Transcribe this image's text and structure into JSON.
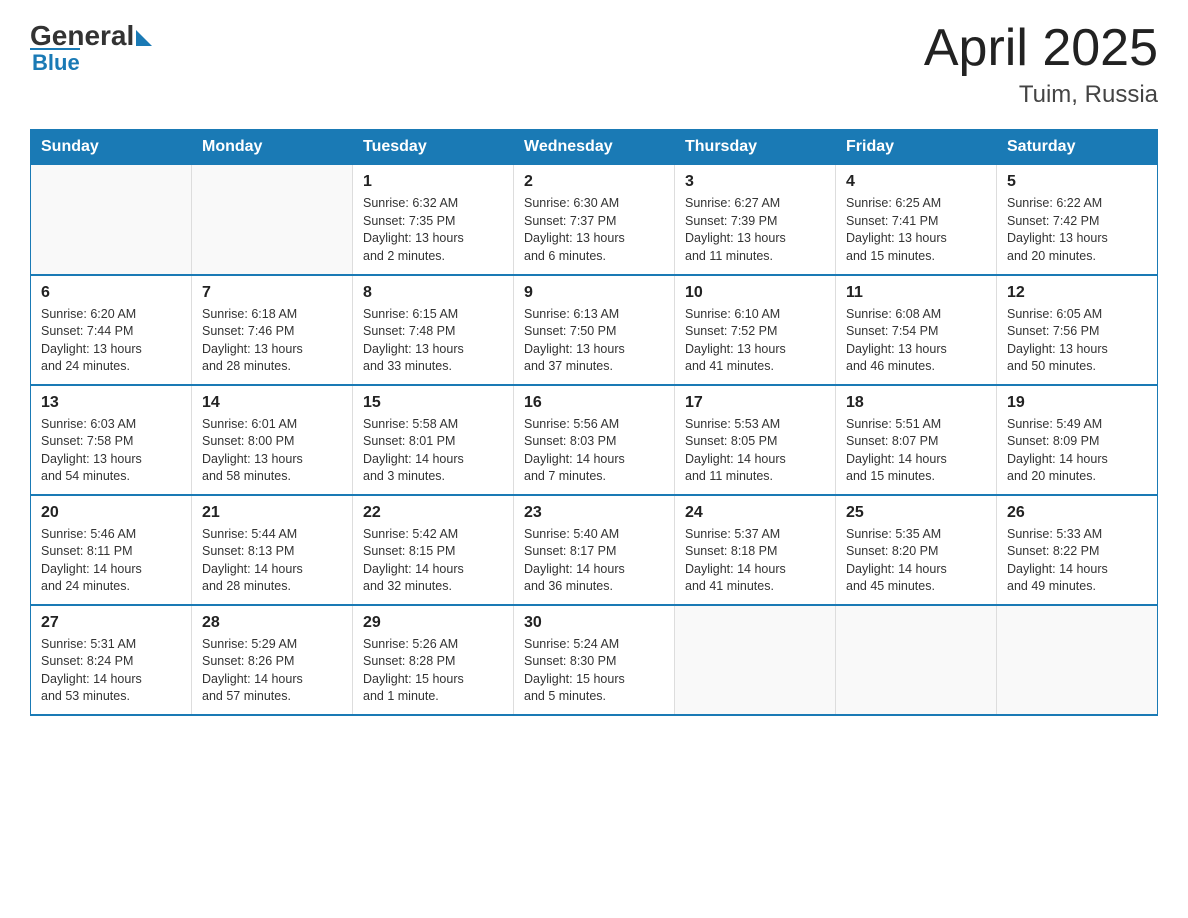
{
  "header": {
    "logo_general": "General",
    "logo_blue": "Blue",
    "title": "April 2025",
    "location": "Tuim, Russia"
  },
  "days_of_week": [
    "Sunday",
    "Monday",
    "Tuesday",
    "Wednesday",
    "Thursday",
    "Friday",
    "Saturday"
  ],
  "weeks": [
    [
      {
        "day": "",
        "info": ""
      },
      {
        "day": "",
        "info": ""
      },
      {
        "day": "1",
        "info": "Sunrise: 6:32 AM\nSunset: 7:35 PM\nDaylight: 13 hours\nand 2 minutes."
      },
      {
        "day": "2",
        "info": "Sunrise: 6:30 AM\nSunset: 7:37 PM\nDaylight: 13 hours\nand 6 minutes."
      },
      {
        "day": "3",
        "info": "Sunrise: 6:27 AM\nSunset: 7:39 PM\nDaylight: 13 hours\nand 11 minutes."
      },
      {
        "day": "4",
        "info": "Sunrise: 6:25 AM\nSunset: 7:41 PM\nDaylight: 13 hours\nand 15 minutes."
      },
      {
        "day": "5",
        "info": "Sunrise: 6:22 AM\nSunset: 7:42 PM\nDaylight: 13 hours\nand 20 minutes."
      }
    ],
    [
      {
        "day": "6",
        "info": "Sunrise: 6:20 AM\nSunset: 7:44 PM\nDaylight: 13 hours\nand 24 minutes."
      },
      {
        "day": "7",
        "info": "Sunrise: 6:18 AM\nSunset: 7:46 PM\nDaylight: 13 hours\nand 28 minutes."
      },
      {
        "day": "8",
        "info": "Sunrise: 6:15 AM\nSunset: 7:48 PM\nDaylight: 13 hours\nand 33 minutes."
      },
      {
        "day": "9",
        "info": "Sunrise: 6:13 AM\nSunset: 7:50 PM\nDaylight: 13 hours\nand 37 minutes."
      },
      {
        "day": "10",
        "info": "Sunrise: 6:10 AM\nSunset: 7:52 PM\nDaylight: 13 hours\nand 41 minutes."
      },
      {
        "day": "11",
        "info": "Sunrise: 6:08 AM\nSunset: 7:54 PM\nDaylight: 13 hours\nand 46 minutes."
      },
      {
        "day": "12",
        "info": "Sunrise: 6:05 AM\nSunset: 7:56 PM\nDaylight: 13 hours\nand 50 minutes."
      }
    ],
    [
      {
        "day": "13",
        "info": "Sunrise: 6:03 AM\nSunset: 7:58 PM\nDaylight: 13 hours\nand 54 minutes."
      },
      {
        "day": "14",
        "info": "Sunrise: 6:01 AM\nSunset: 8:00 PM\nDaylight: 13 hours\nand 58 minutes."
      },
      {
        "day": "15",
        "info": "Sunrise: 5:58 AM\nSunset: 8:01 PM\nDaylight: 14 hours\nand 3 minutes."
      },
      {
        "day": "16",
        "info": "Sunrise: 5:56 AM\nSunset: 8:03 PM\nDaylight: 14 hours\nand 7 minutes."
      },
      {
        "day": "17",
        "info": "Sunrise: 5:53 AM\nSunset: 8:05 PM\nDaylight: 14 hours\nand 11 minutes."
      },
      {
        "day": "18",
        "info": "Sunrise: 5:51 AM\nSunset: 8:07 PM\nDaylight: 14 hours\nand 15 minutes."
      },
      {
        "day": "19",
        "info": "Sunrise: 5:49 AM\nSunset: 8:09 PM\nDaylight: 14 hours\nand 20 minutes."
      }
    ],
    [
      {
        "day": "20",
        "info": "Sunrise: 5:46 AM\nSunset: 8:11 PM\nDaylight: 14 hours\nand 24 minutes."
      },
      {
        "day": "21",
        "info": "Sunrise: 5:44 AM\nSunset: 8:13 PM\nDaylight: 14 hours\nand 28 minutes."
      },
      {
        "day": "22",
        "info": "Sunrise: 5:42 AM\nSunset: 8:15 PM\nDaylight: 14 hours\nand 32 minutes."
      },
      {
        "day": "23",
        "info": "Sunrise: 5:40 AM\nSunset: 8:17 PM\nDaylight: 14 hours\nand 36 minutes."
      },
      {
        "day": "24",
        "info": "Sunrise: 5:37 AM\nSunset: 8:18 PM\nDaylight: 14 hours\nand 41 minutes."
      },
      {
        "day": "25",
        "info": "Sunrise: 5:35 AM\nSunset: 8:20 PM\nDaylight: 14 hours\nand 45 minutes."
      },
      {
        "day": "26",
        "info": "Sunrise: 5:33 AM\nSunset: 8:22 PM\nDaylight: 14 hours\nand 49 minutes."
      }
    ],
    [
      {
        "day": "27",
        "info": "Sunrise: 5:31 AM\nSunset: 8:24 PM\nDaylight: 14 hours\nand 53 minutes."
      },
      {
        "day": "28",
        "info": "Sunrise: 5:29 AM\nSunset: 8:26 PM\nDaylight: 14 hours\nand 57 minutes."
      },
      {
        "day": "29",
        "info": "Sunrise: 5:26 AM\nSunset: 8:28 PM\nDaylight: 15 hours\nand 1 minute."
      },
      {
        "day": "30",
        "info": "Sunrise: 5:24 AM\nSunset: 8:30 PM\nDaylight: 15 hours\nand 5 minutes."
      },
      {
        "day": "",
        "info": ""
      },
      {
        "day": "",
        "info": ""
      },
      {
        "day": "",
        "info": ""
      }
    ]
  ]
}
